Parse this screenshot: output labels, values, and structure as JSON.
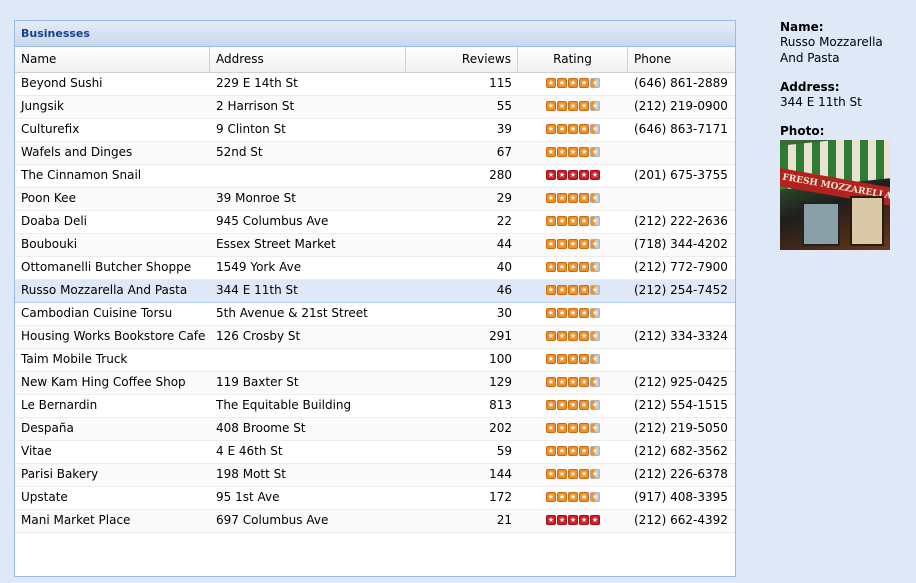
{
  "panel": {
    "title": "Businesses"
  },
  "columns": {
    "name": "Name",
    "address": "Address",
    "reviews": "Reviews",
    "rating": "Rating",
    "phone": "Phone"
  },
  "rows": [
    {
      "name": "Beyond Sushi",
      "address": "229 E 14th St",
      "reviews": "115",
      "rating": 4.5,
      "phone": "(646) 861-2889"
    },
    {
      "name": "Jungsik",
      "address": "2 Harrison St",
      "reviews": "55",
      "rating": 4.5,
      "phone": "(212) 219-0900"
    },
    {
      "name": "Culturefix",
      "address": "9 Clinton St",
      "reviews": "39",
      "rating": 4.5,
      "phone": "(646) 863-7171"
    },
    {
      "name": "Wafels and Dinges",
      "address": "52nd St",
      "reviews": "67",
      "rating": 4.5,
      "phone": ""
    },
    {
      "name": "The Cinnamon Snail",
      "address": "",
      "reviews": "280",
      "rating": 5,
      "phone": "(201) 675-3755"
    },
    {
      "name": "Poon Kee",
      "address": "39 Monroe St",
      "reviews": "29",
      "rating": 4.5,
      "phone": ""
    },
    {
      "name": "Doaba Deli",
      "address": "945 Columbus Ave",
      "reviews": "22",
      "rating": 4.5,
      "phone": "(212) 222-2636"
    },
    {
      "name": "Boubouki",
      "address": "Essex Street Market",
      "reviews": "44",
      "rating": 4.5,
      "phone": "(718) 344-4202"
    },
    {
      "name": "Ottomanelli Butcher Shoppe",
      "address": "1549 York Ave",
      "reviews": "40",
      "rating": 4.5,
      "phone": "(212) 772-7900"
    },
    {
      "name": "Russo Mozzarella And Pasta",
      "address": "344 E 11th St",
      "reviews": "46",
      "rating": 4.5,
      "phone": "(212) 254-7452",
      "selected": true
    },
    {
      "name": "Cambodian Cuisine Torsu",
      "address": "5th Avenue & 21st Street",
      "reviews": "30",
      "rating": 4.5,
      "phone": ""
    },
    {
      "name": "Housing Works Bookstore Cafe",
      "address": "126 Crosby St",
      "reviews": "291",
      "rating": 4.5,
      "phone": "(212) 334-3324"
    },
    {
      "name": "Taim Mobile Truck",
      "address": "",
      "reviews": "100",
      "rating": 4.5,
      "phone": ""
    },
    {
      "name": "New Kam Hing Coffee Shop",
      "address": "119 Baxter St",
      "reviews": "129",
      "rating": 4.5,
      "phone": "(212) 925-0425"
    },
    {
      "name": "Le Bernardin",
      "address": "The Equitable Building",
      "reviews": "813",
      "rating": 4.5,
      "phone": "(212) 554-1515"
    },
    {
      "name": "Despaña",
      "address": "408 Broome St",
      "reviews": "202",
      "rating": 4.5,
      "phone": "(212) 219-5050"
    },
    {
      "name": "Vitae",
      "address": "4 E 46th St",
      "reviews": "59",
      "rating": 4.5,
      "phone": "(212) 682-3562"
    },
    {
      "name": "Parisi Bakery",
      "address": "198 Mott St",
      "reviews": "144",
      "rating": 4.5,
      "phone": "(212) 226-6378"
    },
    {
      "name": "Upstate",
      "address": "95 1st Ave",
      "reviews": "172",
      "rating": 4.5,
      "phone": "(917) 408-3395"
    },
    {
      "name": "Mani Market Place",
      "address": "697 Columbus Ave",
      "reviews": "21",
      "rating": 5,
      "phone": "(212) 662-4392"
    }
  ],
  "detail": {
    "name_label": "Name:",
    "name_value": "Russo Mozzarella And Pasta",
    "address_label": "Address:",
    "address_value": "344 E 11th St",
    "photo_label": "Photo:",
    "photo_sign_text": "FRESH MOZZARELLA & PA"
  },
  "colors": {
    "star_orange": "#f0902a",
    "star_red": "#d2202a",
    "selected_row": "#dfe8f6",
    "header_text": "#15428b"
  }
}
